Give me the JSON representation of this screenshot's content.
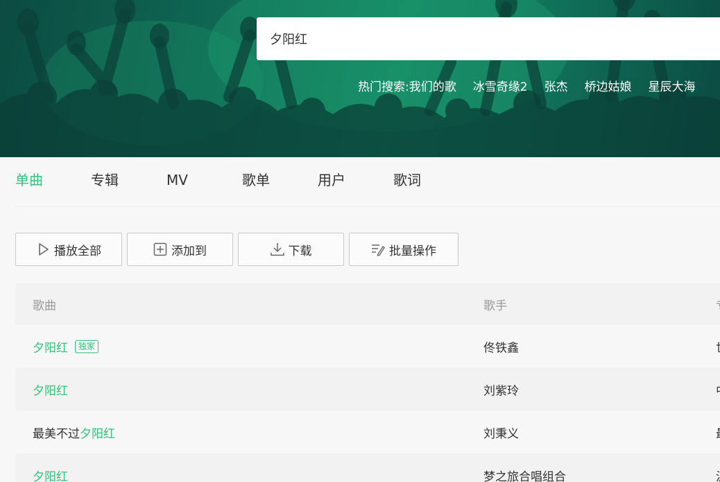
{
  "search": {
    "query": "夕阳红"
  },
  "hot_search": {
    "label": "热门搜索:",
    "items": [
      "我们的歌",
      "冰雪奇缘2",
      "张杰",
      "桥边姑娘",
      "星辰大海"
    ]
  },
  "tabs": [
    {
      "label": "单曲",
      "active": true
    },
    {
      "label": "专辑",
      "active": false
    },
    {
      "label": "MV",
      "active": false
    },
    {
      "label": "歌单",
      "active": false
    },
    {
      "label": "用户",
      "active": false
    },
    {
      "label": "歌词",
      "active": false
    }
  ],
  "actions": {
    "play_all": "播放全部",
    "add_to": "添加到",
    "download": "下载",
    "batch": "批量操作"
  },
  "table": {
    "columns": [
      "歌曲",
      "歌手",
      "专"
    ],
    "rows": [
      {
        "song_prefix": "",
        "song_hl": "夕阳红",
        "badge": "独家",
        "singer": "佟铁鑫",
        "album": "世"
      },
      {
        "song_prefix": "",
        "song_hl": "夕阳红",
        "badge": "",
        "singer": "刘紫玲",
        "album": "中"
      },
      {
        "song_prefix": "最美不过",
        "song_hl": "夕阳红",
        "badge": "",
        "singer": "刘秉义",
        "album": "最"
      },
      {
        "song_prefix": "",
        "song_hl": "夕阳红",
        "badge": "",
        "singer": "梦之旅合唱组合",
        "album": "温"
      }
    ]
  },
  "colors": {
    "accent": "#31c27c",
    "banner": "#17936b"
  }
}
